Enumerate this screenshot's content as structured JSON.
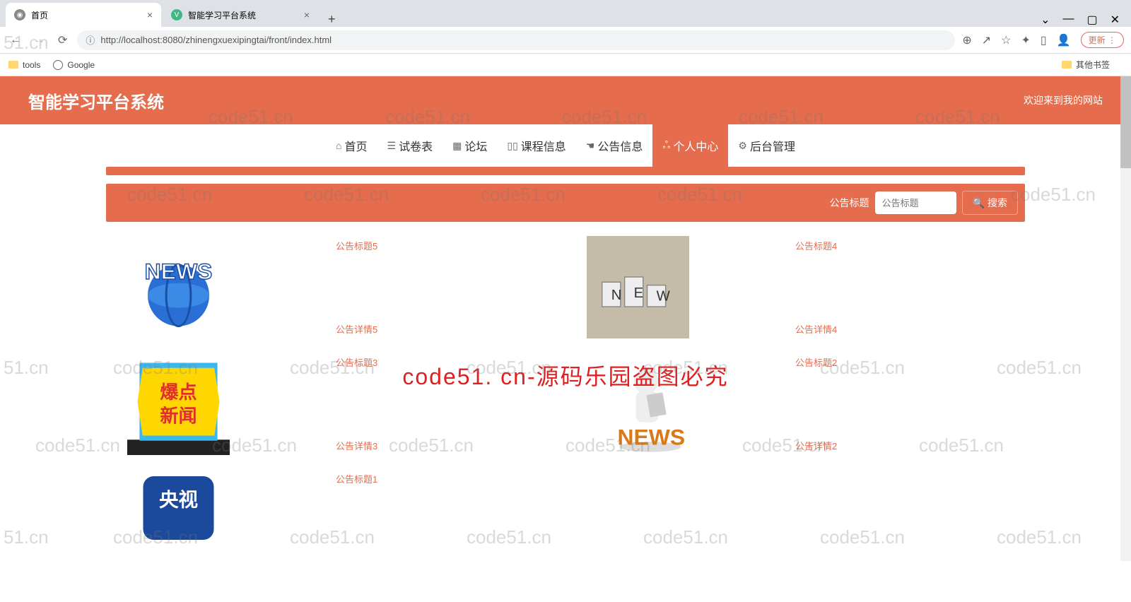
{
  "browser": {
    "tab1_title": "首页",
    "tab2_title": "智能学习平台系统",
    "url": "http://localhost:8080/zhinengxuexipingtai/front/index.html",
    "update_label": "更新",
    "bm_tools": "tools",
    "bm_google": "Google",
    "bm_other": "其他书签"
  },
  "header": {
    "title": "智能学习平台系统",
    "welcome": "欢迎来到我的网站"
  },
  "nav": {
    "home": "首页",
    "exams": "试卷表",
    "forum": "论坛",
    "courses": "课程信息",
    "notices": "公告信息",
    "personal": "个人中心",
    "admin": "后台管理"
  },
  "search": {
    "label": "公告标题",
    "placeholder": "公告标题",
    "btn": "搜索"
  },
  "cards": [
    {
      "left": {
        "title": "公告标题5",
        "detail": "公告详情5"
      },
      "right": {
        "title": "公告标题4",
        "detail": "公告详情4"
      }
    },
    {
      "left": {
        "title": "公告标题3",
        "detail": "公告详情3"
      },
      "right": {
        "title": "公告标题2",
        "detail": "公告详情2"
      }
    },
    {
      "left": {
        "title": "公告标题1"
      }
    }
  ],
  "watermark": {
    "main": "code51. cn-源码乐园盗图必究",
    "tag": "code51.cn",
    "site_small": "51.cn"
  }
}
